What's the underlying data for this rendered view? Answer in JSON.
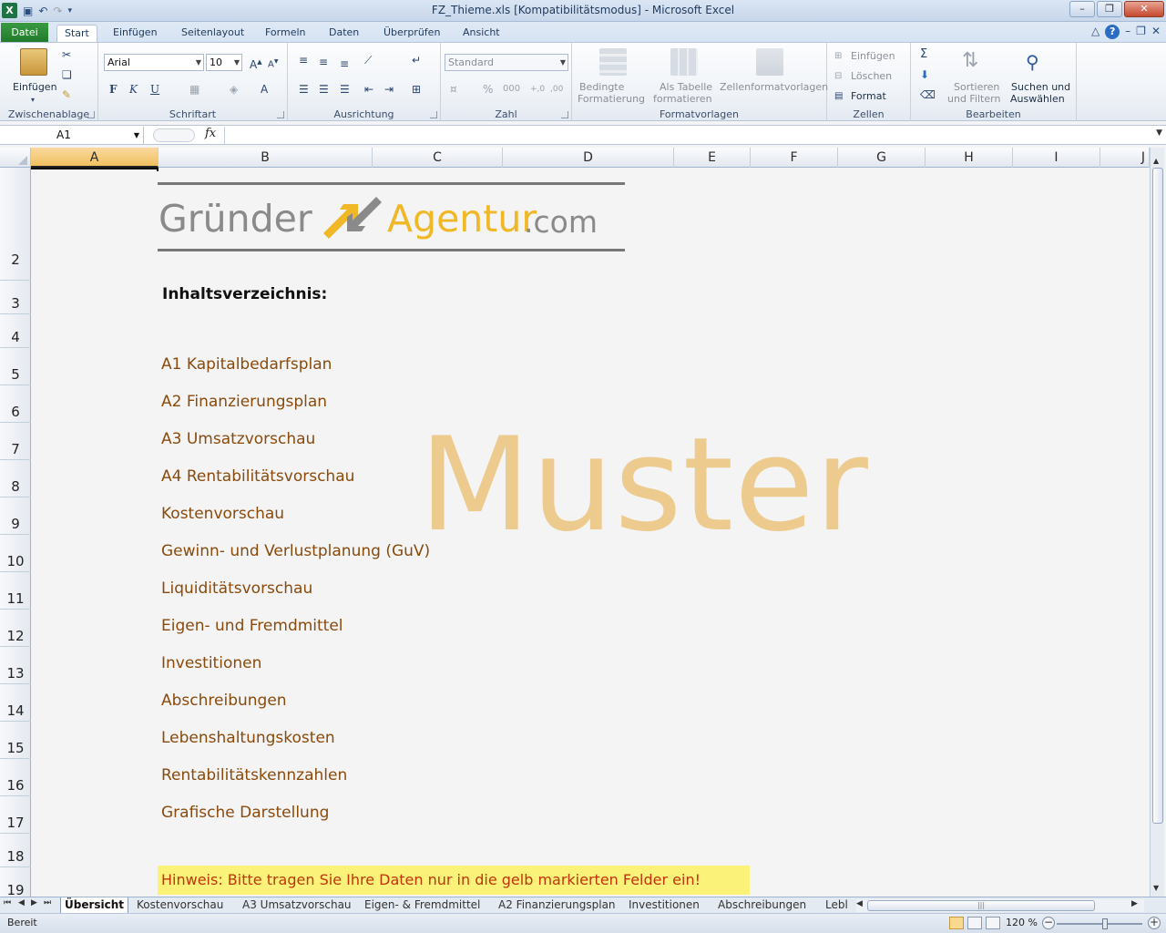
{
  "window": {
    "title": "FZ_Thieme.xls  [Kompatibilitätsmodus]  -  Microsoft Excel",
    "app_icon": "X",
    "controls": {
      "minimize": "–",
      "restore": "❐",
      "close": "✕"
    }
  },
  "ribbon_tabs": [
    {
      "label": "Datei"
    },
    {
      "label": "Start",
      "active": true
    },
    {
      "label": "Einfügen"
    },
    {
      "label": "Seitenlayout"
    },
    {
      "label": "Formeln"
    },
    {
      "label": "Daten"
    },
    {
      "label": "Überprüfen"
    },
    {
      "label": "Ansicht"
    }
  ],
  "ribbon": {
    "clipboard": {
      "label": "Zwischenablage",
      "paste": "Einfügen"
    },
    "font": {
      "label": "Schriftart",
      "name": "Arial",
      "size": "10",
      "bold": "F",
      "italic": "K",
      "underline": "U"
    },
    "alignment": {
      "label": "Ausrichtung"
    },
    "number": {
      "label": "Zahl",
      "format": "Standard",
      "percent": "%",
      "thousands": "000"
    },
    "styles": {
      "label": "Formatvorlagen",
      "conditional_1": "Bedingte",
      "conditional_2": "Formatierung",
      "table_1": "Als Tabelle",
      "table_2": "formatieren",
      "cell_styles": "Zellenformatvorlagen"
    },
    "cells": {
      "label": "Zellen",
      "insert": "Einfügen",
      "delete": "Löschen",
      "format": "Format"
    },
    "editing": {
      "label": "Bearbeiten",
      "sigma": "Σ",
      "sort_1": "Sortieren",
      "sort_2": "und Filtern",
      "find_1": "Suchen und",
      "find_2": "Auswählen"
    }
  },
  "formula_bar": {
    "name_box": "A1",
    "fx": "fx",
    "formula": ""
  },
  "columns": [
    "A",
    "B",
    "C",
    "D",
    "E",
    "F",
    "G",
    "H",
    "I",
    "J"
  ],
  "rows": [
    "2",
    "3",
    "4",
    "5",
    "6",
    "7",
    "8",
    "9",
    "10",
    "11",
    "12",
    "13",
    "14",
    "15",
    "16",
    "17",
    "18",
    "19"
  ],
  "sheet": {
    "logo": {
      "part1": "Gründer",
      "part2": "Agentur",
      "part3": ".com"
    },
    "toc_title": "Inhaltsverzeichnis:",
    "toc": [
      "A1 Kapitalbedarfsplan",
      "A2 Finanzierungsplan",
      "A3 Umsatzvorschau",
      "A4 Rentabilitätsvorschau",
      "Kostenvorschau",
      "Gewinn- und Verlustplanung (GuV)",
      "Liquiditätsvorschau",
      "Eigen- und Fremdmittel",
      "Investitionen",
      "Abschreibungen",
      "Lebenshaltungskosten",
      "Rentabilitätskennzahlen",
      "Grafische Darstellung"
    ],
    "watermark": "Muster",
    "hint": "Hinweis: Bitte tragen Sie Ihre Daten nur in die gelb markierten Felder ein!"
  },
  "sheet_tabs": [
    {
      "label": "Übersicht",
      "active": true
    },
    {
      "label": "Kostenvorschau"
    },
    {
      "label": "A3 Umsatzvorschau"
    },
    {
      "label": "Eigen- & Fremdmittel"
    },
    {
      "label": "A2 Finanzierungsplan"
    },
    {
      "label": "Investitionen"
    },
    {
      "label": "Abschreibungen"
    },
    {
      "label": "Lebl"
    }
  ],
  "status": {
    "ready": "Bereit",
    "zoom": "120 %"
  },
  "colors": {
    "link": "#8a4a0c",
    "hint_bg": "#fbf27a",
    "hint_text": "#c0340c",
    "watermark": "#ecc37a",
    "logo_yellow": "#f0b726"
  }
}
